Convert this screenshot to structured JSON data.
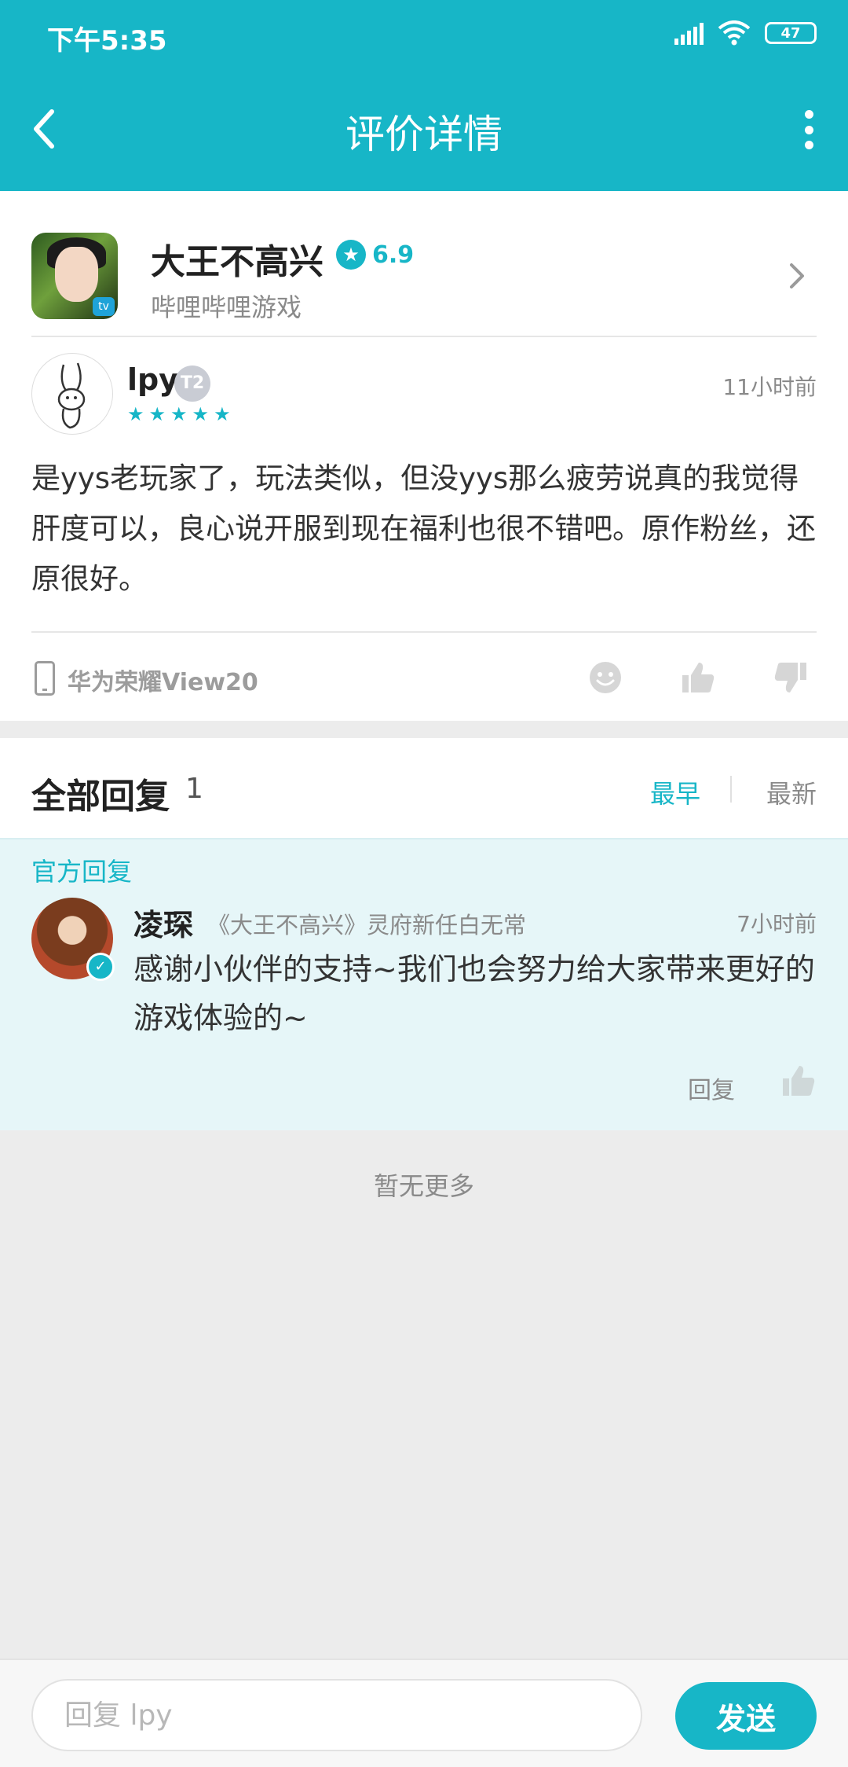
{
  "status_bar": {
    "time": "下午5:35",
    "battery": "47"
  },
  "header": {
    "title": "评价详情",
    "back_icon": "chevron-left-icon",
    "more_icon": "more-vertical-icon"
  },
  "game": {
    "name": "大王不高兴",
    "rating": "6.9",
    "publisher": "哔哩哔哩游戏"
  },
  "review": {
    "author": "lpy",
    "level": "T2",
    "stars": 5,
    "time": "11小时前",
    "text": "是yys老玩家了，玩法类似，但没yys那么疲劳说真的我觉得肝度可以，良心说开服到现在福利也很不错吧。原作粉丝，还原很好。",
    "device": "华为荣耀View20"
  },
  "replies": {
    "title": "全部回复",
    "count": "1",
    "sort_earliest": "最早",
    "sort_latest": "最新",
    "official_label": "官方回复",
    "items": [
      {
        "name": "凌琛",
        "title": "《大王不高兴》灵府新任白无常",
        "time": "7小时前",
        "text": "感谢小伙伴的支持~我们也会努力给大家带来更好的游戏体验的~",
        "reply_label": "回复"
      }
    ],
    "no_more": "暂无更多"
  },
  "composer": {
    "placeholder": "回复 lpy",
    "send_label": "发送"
  },
  "colors": {
    "accent": "#17b6c7",
    "official_bg": "#e6f6f8"
  }
}
